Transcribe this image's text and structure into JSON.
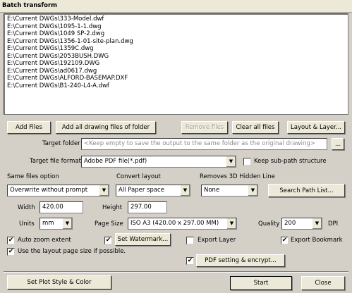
{
  "window": {
    "title": "Batch transform"
  },
  "files": [
    "E:\\Current DWGs\\333-Model.dwf",
    "E:\\Current DWGs\\1095-1-1.dwg",
    "E:\\Current DWGs\\1049 SP-2.dwg",
    "E:\\Current DWGs\\1356-1-01-site-plan.dwg",
    "E:\\Current DWGs\\1359C.dwg",
    "E:\\Current DWGs\\2053BUSH.DWG",
    "E:\\Current DWGs\\192109.DWG",
    "E:\\Current DWGs\\ad0617.dwg",
    "E:\\Current DWGs\\ALFORD-BASEMAP.DXF",
    "E:\\Current DWGs\\B1-240-L4-A.dwf"
  ],
  "buttons": {
    "add_files": "Add Files",
    "add_all": "Add all drawing files of folder",
    "remove_files": "Remove files",
    "clear_all": "Clear all files",
    "layout_layer": "Layout & Layer...",
    "browse": "...",
    "search_path": "Search Path List...",
    "set_watermark": "Set Watermark...",
    "pdf_setting": "PDF setting & encrypt...",
    "plot_style": "Set Plot Style & Color",
    "start": "Start",
    "close": "Close"
  },
  "target_folder": {
    "label": "Target folder",
    "placeholder": "<Keep empty to save the output to the same folder as the original drawing>"
  },
  "target_format": {
    "label": "Target file format",
    "value": "Adobe PDF file(*.pdf)"
  },
  "keep_subpath": {
    "label": "Keep sub-path structure",
    "checked": false
  },
  "same_files": {
    "label": "Same files option",
    "value": "Overwrite without prompt"
  },
  "convert_layout": {
    "label": "Convert layout",
    "value": "All Paper space"
  },
  "hidden_line": {
    "label": "Removes 3D Hidden Line",
    "value": "None"
  },
  "width": {
    "label": "Width",
    "value": "420.00"
  },
  "height": {
    "label": "Height",
    "value": "297.00"
  },
  "units": {
    "label": "Units",
    "value": "mm"
  },
  "page_size": {
    "label": "Page Size",
    "value": "ISO A3 (420.00 x 297.00 MM)"
  },
  "quality": {
    "label": "Quality",
    "value": "200",
    "unit": "DPI"
  },
  "auto_zoom": {
    "label": "Auto zoom extent",
    "checked": true
  },
  "use_layout": {
    "label": "Use the layout page size if possible.",
    "checked": true
  },
  "set_watermark_check": {
    "checked": true
  },
  "export_layer": {
    "label": "Export Layer",
    "checked": false
  },
  "export_bookmark": {
    "label": "Export Bookmark",
    "checked": true
  },
  "pdf_setting_check": {
    "checked": true
  },
  "check_glyph": "✔",
  "arrow_glyph": "▼"
}
